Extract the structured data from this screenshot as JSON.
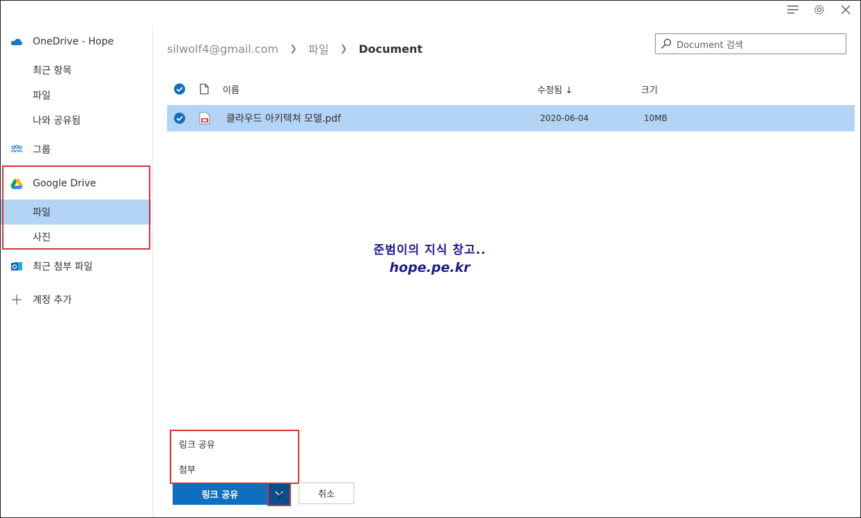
{
  "window": {
    "icons": [
      "menu-lines-icon",
      "gear-icon",
      "close-icon"
    ]
  },
  "sidebar": {
    "onedrive": {
      "label": "OneDrive - Hope",
      "icon": "cloud-icon"
    },
    "onedrive_items": [
      "최근 항목",
      "파일",
      "나와 공유됨"
    ],
    "groups": {
      "label": "그룹",
      "icon": "groups-icon"
    },
    "google_drive": {
      "label": "Google Drive",
      "icon": "google-drive-icon"
    },
    "google_items": {
      "files": "파일",
      "photos": "사진"
    },
    "recent_attachments": {
      "label": "최근 첨부 파일",
      "icon": "outlook-icon"
    },
    "add_account": {
      "label": "계정 추가",
      "icon": "plus-icon"
    }
  },
  "header": {
    "breadcrumb": [
      "silwolf4@gmail.com",
      "파일",
      "Document"
    ],
    "search_placeholder": "Document 검색"
  },
  "list": {
    "columns": {
      "name": "이름",
      "modified": "수정됨 ↓",
      "size": "크기"
    },
    "rows": [
      {
        "name": "클라우드 아키텍쳐 모델.pdf",
        "modified": "2020-06-04",
        "size": "10MB",
        "selected": true
      }
    ]
  },
  "watermark": {
    "line1": "준범이의 지식 창고..",
    "line2": "hope.pe.kr"
  },
  "share_menu": {
    "items": [
      "링크 공유",
      "첨부"
    ]
  },
  "actions": {
    "primary": "링크 공유",
    "cancel": "취소"
  },
  "colors": {
    "accent": "#106ebe",
    "selection": "#b3d4f5",
    "highlight_box": "#d13438"
  }
}
